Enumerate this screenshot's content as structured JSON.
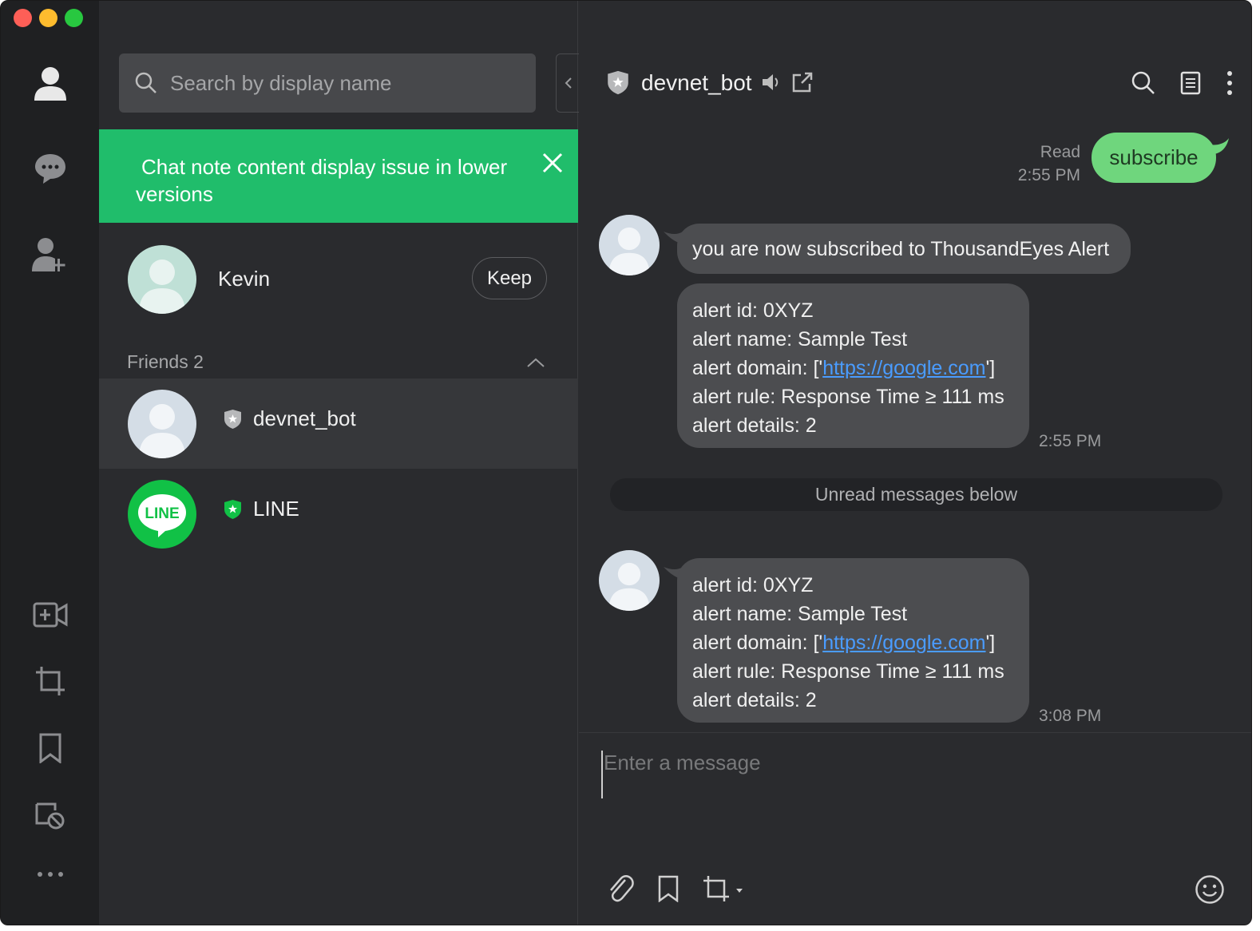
{
  "rail": {
    "items": [
      "profile-icon",
      "chats-icon",
      "add-friend-icon",
      "video-call-icon",
      "screenshot-crop-icon",
      "keep-bookmark-icon",
      "mute-notifications-icon",
      "more-icon"
    ]
  },
  "friends_panel": {
    "search_placeholder": "Search by display name",
    "banner_text": "Chat note content display issue in lower versions",
    "profile": {
      "name": "Kevin",
      "keep_label": "Keep"
    },
    "section_label": "Friends 2",
    "friends": [
      {
        "name": "devnet_bot",
        "badge_color": "#b7b8ba"
      },
      {
        "name": "LINE",
        "badge_color": "#11c146",
        "logo_text": "LINE"
      }
    ]
  },
  "chat": {
    "title": "devnet_bot",
    "outgoing": {
      "text": "subscribe",
      "status": "Read",
      "time": "2:55 PM"
    },
    "incoming_1": {
      "text": "you are now subscribed to ThousandEyes Alert"
    },
    "alert_1": {
      "line1": "alert id: 0XYZ",
      "line2": "alert name: Sample Test",
      "line3_pre": "alert domain: ['",
      "line3_link": "https://google.com",
      "line3_post": "']",
      "line4": "alert rule: Response Time ≥ 111 ms",
      "line5": "alert details: 2",
      "time": "2:55 PM"
    },
    "unread_label": "Unread messages below",
    "alert_2": {
      "line1": "alert id: 0XYZ",
      "line2": "alert name: Sample Test",
      "line3_pre": "alert domain: ['",
      "line3_link": "https://google.com",
      "line3_post": "']",
      "line4": "alert rule: Response Time ≥ 111 ms",
      "line5": "alert details: 2",
      "time": "3:08 PM"
    },
    "composer_placeholder": "Enter a message"
  },
  "colors": {
    "accent_green": "#20bd6b",
    "outgoing_bubble": "#6fd67d",
    "link": "#4a9cff"
  }
}
